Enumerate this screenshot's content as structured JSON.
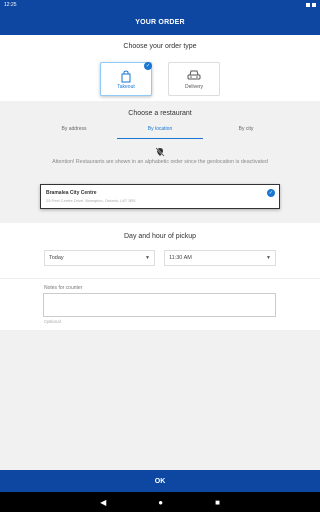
{
  "status_bar": {
    "time": "12:25"
  },
  "app_bar": {
    "title": "YOUR ORDER"
  },
  "order_type": {
    "title": "Choose your order type",
    "options": [
      {
        "label": "Takeout",
        "selected": true
      },
      {
        "label": "Delivery",
        "selected": false
      }
    ]
  },
  "restaurant": {
    "title": "Choose a restaurant",
    "tabs": [
      {
        "label": "By address",
        "active": false
      },
      {
        "label": "By location",
        "active": true
      },
      {
        "label": "By city",
        "active": false
      }
    ],
    "attention": "Attention! Restaurants are shown in an alphabetic order since the geolocation is deactivated",
    "selected": {
      "name": "Bramalea City Centre",
      "address": "25 Peel Centre Drive, Brampton, Ontario, L6T 3R5"
    }
  },
  "pickup": {
    "title": "Day and hour of pickup",
    "day": "Today",
    "hour": "11:30 AM"
  },
  "notes": {
    "label": "Notes for counter",
    "hint": "Optional"
  },
  "ok_button": {
    "label": "OK"
  },
  "colors": {
    "primary": "#0d47a1",
    "accent": "#1976d2",
    "background": "#f1f1f1"
  }
}
